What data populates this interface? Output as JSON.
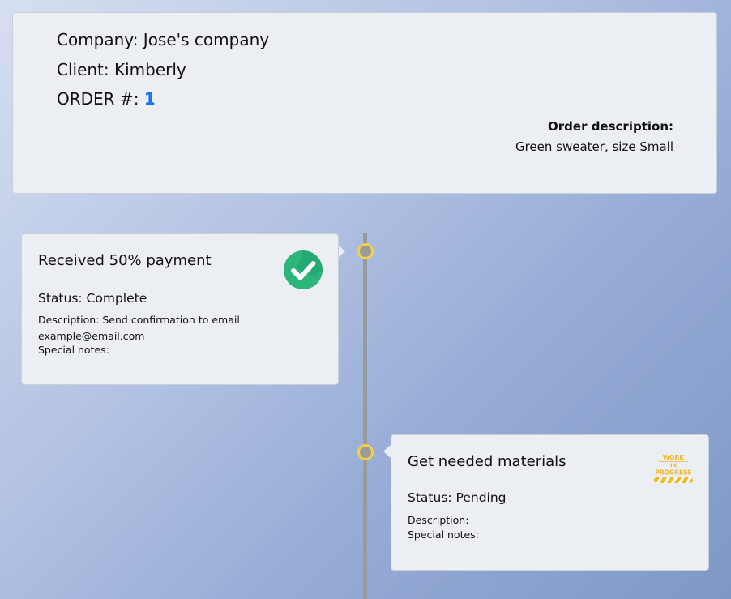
{
  "header": {
    "company_label": "Company:",
    "company_value": "Jose's company",
    "client_label": "Client:",
    "client_value": "Kimberly",
    "order_label": "ORDER #:",
    "order_number": "1",
    "description_title": "Order description:",
    "description_text": "Green sweater, size Small"
  },
  "steps": [
    {
      "title": "Received 50% payment",
      "status": "Status: Complete",
      "description": "Description: Send confirmation to email example@email.com",
      "notes": "Special notes:",
      "icon": "check-circle-icon",
      "icon_color": "#2db67c"
    },
    {
      "title": "Get needed materials",
      "status": "Status: Pending",
      "description": "Description:",
      "notes": "Special notes:",
      "icon": "work-in-progress-icon",
      "icon_color": "#f4b623",
      "badge_lines": [
        "WORK",
        "IN",
        "PROGRESS"
      ]
    }
  ],
  "colors": {
    "order_number": "#1a73e8",
    "timeline_line": "#9a9a9a",
    "timeline_dot_ring": "#f2cf48",
    "card_background": "#ebeef3"
  }
}
